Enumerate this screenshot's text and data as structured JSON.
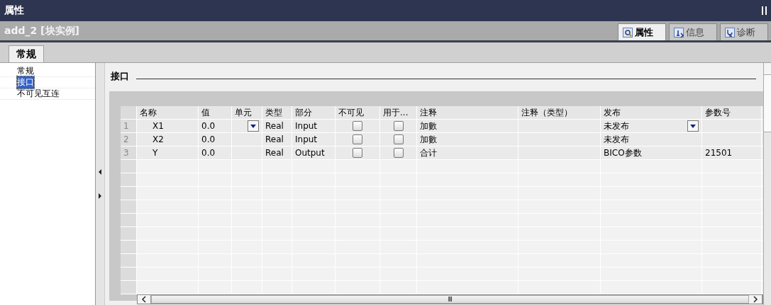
{
  "window": {
    "title": "属性"
  },
  "object": {
    "name": "add_2 [块实例]"
  },
  "view_tabs": [
    {
      "label": "属性",
      "selected": true
    },
    {
      "label": "信息",
      "selected": false
    },
    {
      "label": "诊断",
      "selected": false
    }
  ],
  "tabs": [
    {
      "label": "常规",
      "selected": true
    }
  ],
  "sidebar": {
    "items": [
      {
        "label": "常规",
        "selected": false
      },
      {
        "label": "接口",
        "selected": true
      },
      {
        "label": "不可见互连",
        "selected": false
      }
    ]
  },
  "section": {
    "title": "接口"
  },
  "table": {
    "columns": [
      "名称",
      "值",
      "单元",
      "类型",
      "部分",
      "不可见",
      "用于...",
      "注释",
      "注释（类型）",
      "发布",
      "参数号"
    ],
    "rows": [
      {
        "index": "1",
        "name": "X1",
        "value": "0.0",
        "unit_dropdown": true,
        "type": "Real",
        "part": "Input",
        "invisible": false,
        "used_for": false,
        "comment": "加數",
        "publish": "未发布",
        "publish_dropdown": true
      },
      {
        "index": "2",
        "name": "X2",
        "value": "0.0",
        "unit_dropdown": false,
        "type": "Real",
        "part": "Input",
        "invisible": false,
        "used_for": false,
        "comment": "加數",
        "publish": "未发布",
        "publish_dropdown": false
      },
      {
        "index": "3",
        "name": "Y",
        "value": "0.0",
        "unit_dropdown": false,
        "type": "Real",
        "part": "Output",
        "invisible": false,
        "used_for": false,
        "comment": "合计",
        "publish": "BICO参数",
        "publish_dropdown": false,
        "param_no": "21501"
      }
    ]
  },
  "hscroll": {
    "grip": "Ⅲ"
  }
}
